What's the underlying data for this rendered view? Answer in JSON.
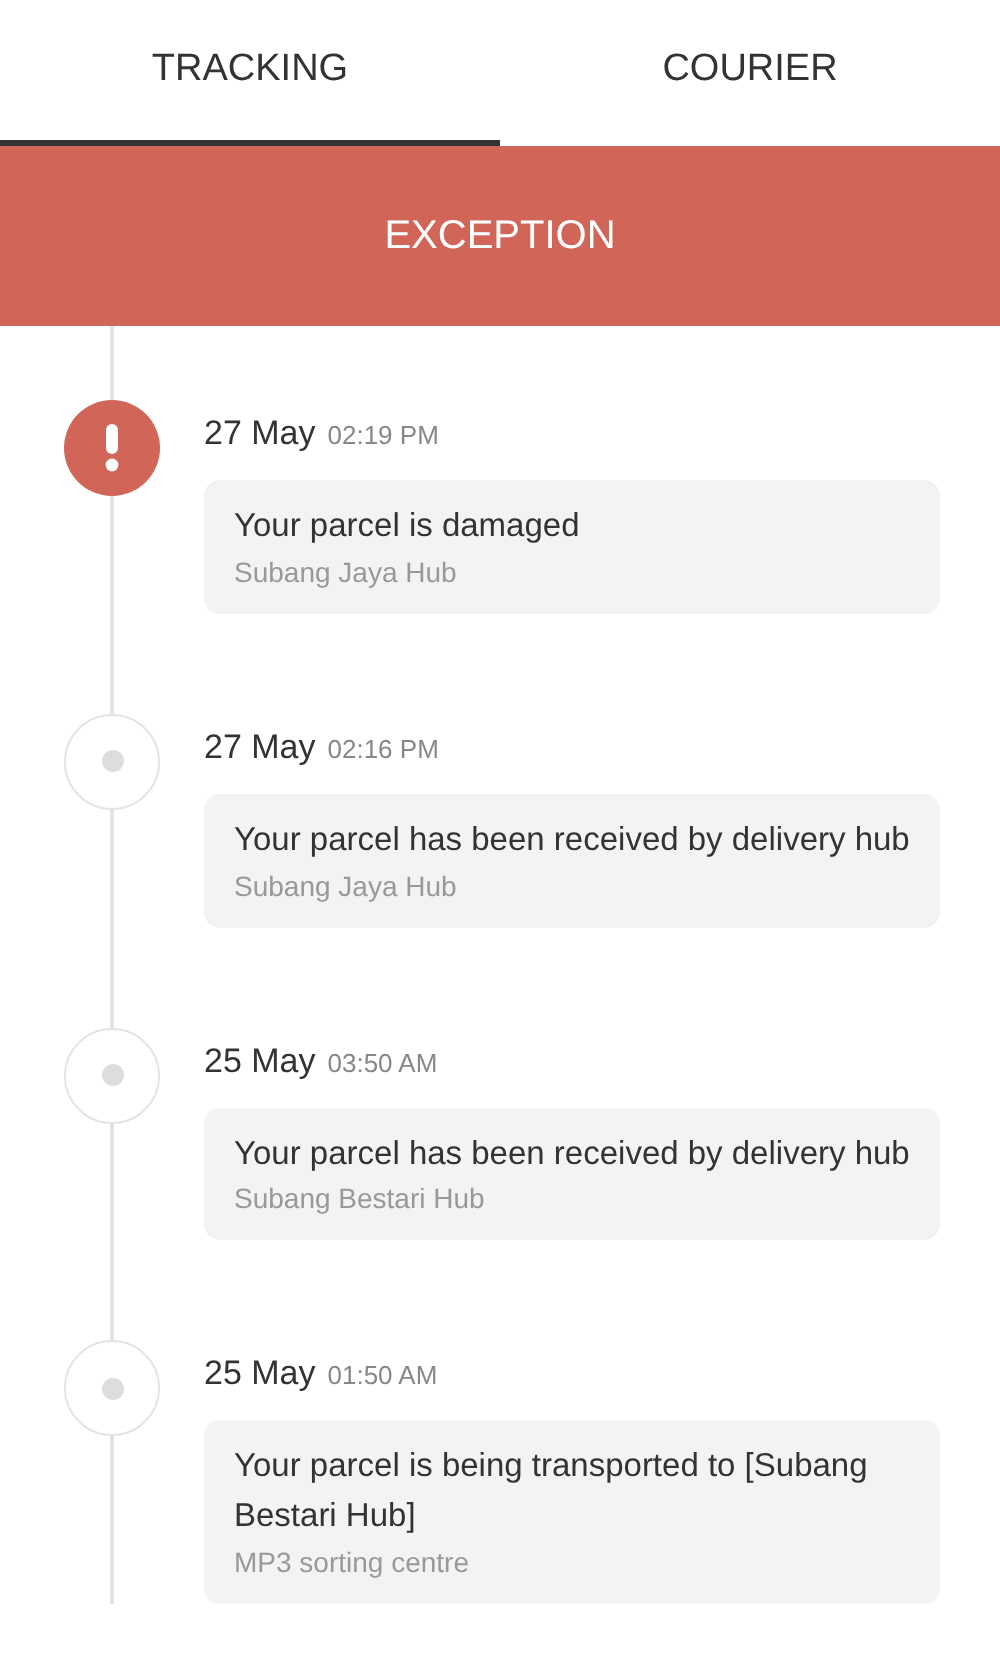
{
  "tabs": [
    {
      "label": "TRACKING",
      "selected": true
    },
    {
      "label": "COURIER",
      "selected": false
    }
  ],
  "status_banner": {
    "label": "EXCEPTION"
  },
  "events": [
    {
      "kind": "exception",
      "date": "27 May",
      "time": "02:19 PM",
      "message": "Your parcel is damaged",
      "location": "Subang Jaya Hub"
    },
    {
      "kind": "normal",
      "date": "27 May",
      "time": "02:16 PM",
      "message": "Your parcel has been received by delivery hub",
      "location": "Subang Jaya Hub"
    },
    {
      "kind": "normal",
      "date": "25 May",
      "time": "03:50 AM",
      "message": "Your parcel has been received by delivery hub",
      "location": "Subang Bestari Hub"
    },
    {
      "kind": "normal",
      "date": "25 May",
      "time": "01:50 AM",
      "message": "Your parcel is being transported to [Subang Bestari Hub]",
      "location": "MP3 sorting centre"
    }
  ]
}
